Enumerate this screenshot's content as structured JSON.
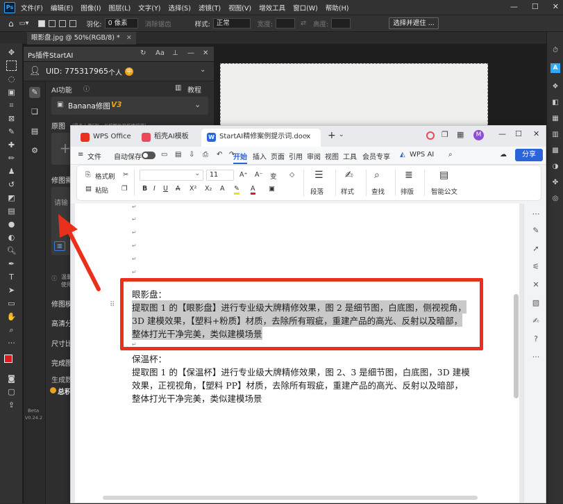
{
  "photoshop": {
    "logo": "Ps",
    "menu": [
      "文件(F)",
      "编辑(E)",
      "图像(I)",
      "图层(L)",
      "文字(Y)",
      "选择(S)",
      "滤镜(T)",
      "视图(V)",
      "增效工具",
      "窗口(W)",
      "帮助(H)"
    ],
    "options": {
      "feather_label": "羽化:",
      "feather_value": "0 像素",
      "antialias_label": "消除锯齿",
      "style_label": "样式:",
      "style_value": "正常",
      "width_label": "宽度:",
      "height_label": "高度:",
      "select_mask_button": "选择并遮住 ..."
    },
    "document_tab": "眼影盘.jpg @ 50%(RGB/8) *"
  },
  "plugin": {
    "title": "Ps插件StartAI",
    "uid_label": "UID: 775317965",
    "account_type": "个人",
    "ai_function_label": "AI功能",
    "tutorial_label": "教程",
    "model_name": "Banana修图",
    "model_version": "V3",
    "original_label": "原图",
    "original_hint": "（最多上传5张，长按图片可拖拽排序）",
    "prompt_label": "修图需",
    "prompt_placeholder": "请输",
    "section_warn": "温馨",
    "section_warn_2": "使用",
    "sections": [
      "修图模",
      "高清分",
      "尺寸比",
      "完成图",
      "生成数"
    ],
    "points_label": "总积",
    "beta_label": "Beta",
    "version": "V0.24.2"
  },
  "wps": {
    "tabs": [
      {
        "label": "WPS Office",
        "color": "#e8311f"
      },
      {
        "label": "稻壳AI模板",
        "color": "#e84a5a"
      },
      {
        "label": "StartAI精修案例提示词.docx",
        "color": "#2b63d9"
      }
    ],
    "avatar_letter": "M",
    "menu": [
      "文件",
      "自动保存",
      "开始",
      "插入",
      "页面",
      "引用",
      "审阅",
      "视图",
      "工具",
      "会员专享",
      "WPS AI"
    ],
    "share_label": "分享",
    "ribbon": {
      "format_painter": "格式刷",
      "paste": "粘贴",
      "font_size": "11",
      "paragraph": "段落",
      "style": "样式",
      "find": "查找",
      "layout": "排版",
      "smart_doc": "智能公文"
    },
    "document": {
      "heading1": "眼影盘：",
      "para1_lines": [
        "提取图 1 的【眼影盘】进行专业级大牌精修效果，图 2 是细节图，白底图，侧视视角，",
        "3D 建模效果，【塑料+粉质】材质，去除所有瑕疵，重建产品的高光、反射以及暗部，",
        "整体打光干净完美，类似建模场景"
      ],
      "heading2": "保温杯：",
      "para2_lines": [
        "提取图 1 的【保温杯】进行专业级大牌精修效果，图 2、3 是细节图，白底图，3D 建模",
        "效果，正视视角，【塑料 PP】材质，去除所有瑕疵，重建产品的高光、反射以及暗部，",
        "整体打光干净完美，类似建模场景"
      ]
    }
  },
  "annotation_color": "#e8301c"
}
